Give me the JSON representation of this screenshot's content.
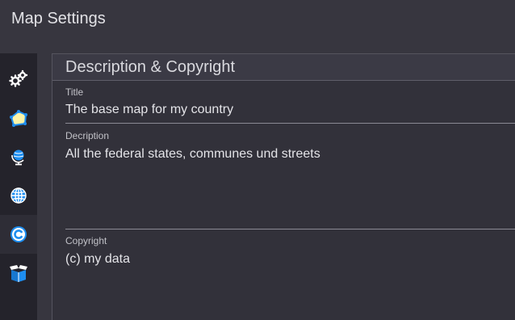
{
  "window": {
    "title": "Map Settings"
  },
  "sidebar": {
    "items": [
      {
        "name": "settings",
        "icon": "gears-icon"
      },
      {
        "name": "layers",
        "icon": "polygon-icon"
      },
      {
        "name": "projection",
        "icon": "globe-stand-icon"
      },
      {
        "name": "web",
        "icon": "globe-grid-icon"
      },
      {
        "name": "copyright",
        "icon": "copyright-icon",
        "active": true
      },
      {
        "name": "package",
        "icon": "box-icon"
      }
    ],
    "icon_color": "#1e8ef0"
  },
  "panel": {
    "title": "Description & Copyright",
    "fields": {
      "title": {
        "label": "Title",
        "value": "The base map for my country"
      },
      "description": {
        "label": "Decription",
        "value": "All the federal states, communes und streets"
      },
      "copyright": {
        "label": "Copyright",
        "value": "(c) my data"
      }
    }
  }
}
